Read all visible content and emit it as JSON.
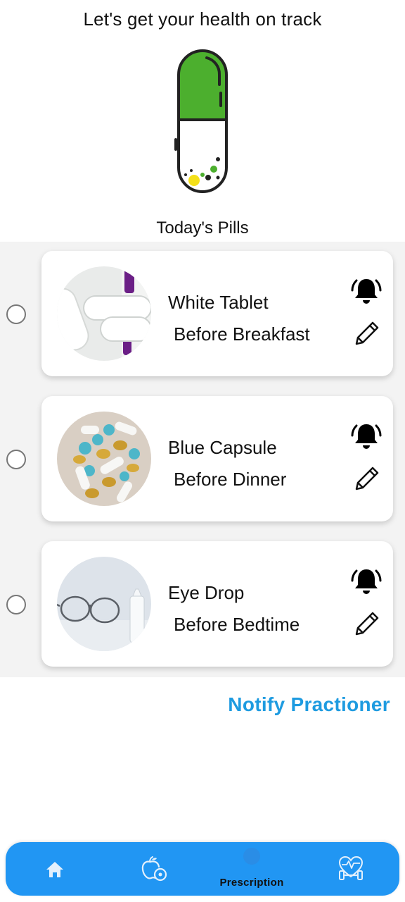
{
  "header": {
    "title": "Let's get your health on track"
  },
  "section": {
    "title": "Today's Pills"
  },
  "pills": [
    {
      "name": "White Tablet",
      "time": "Before Breakfast"
    },
    {
      "name": "Blue Capsule",
      "time": "Before Dinner"
    },
    {
      "name": "Eye Drop",
      "time": "Before Bedtime"
    }
  ],
  "actions": {
    "notify_label": "Notify Practioner"
  },
  "nav": {
    "items": [
      {
        "icon": "home-icon"
      },
      {
        "icon": "apple-clock-icon"
      },
      {
        "icon": "prescription-icon",
        "label": "Prescription"
      },
      {
        "icon": "heart-dumbbell-icon"
      }
    ]
  },
  "colors": {
    "accent": "#2196f3",
    "link": "#1e9be0",
    "capsule_green": "#4caf2e",
    "background": "#ffffff",
    "row_background": "#f3f3f3"
  }
}
